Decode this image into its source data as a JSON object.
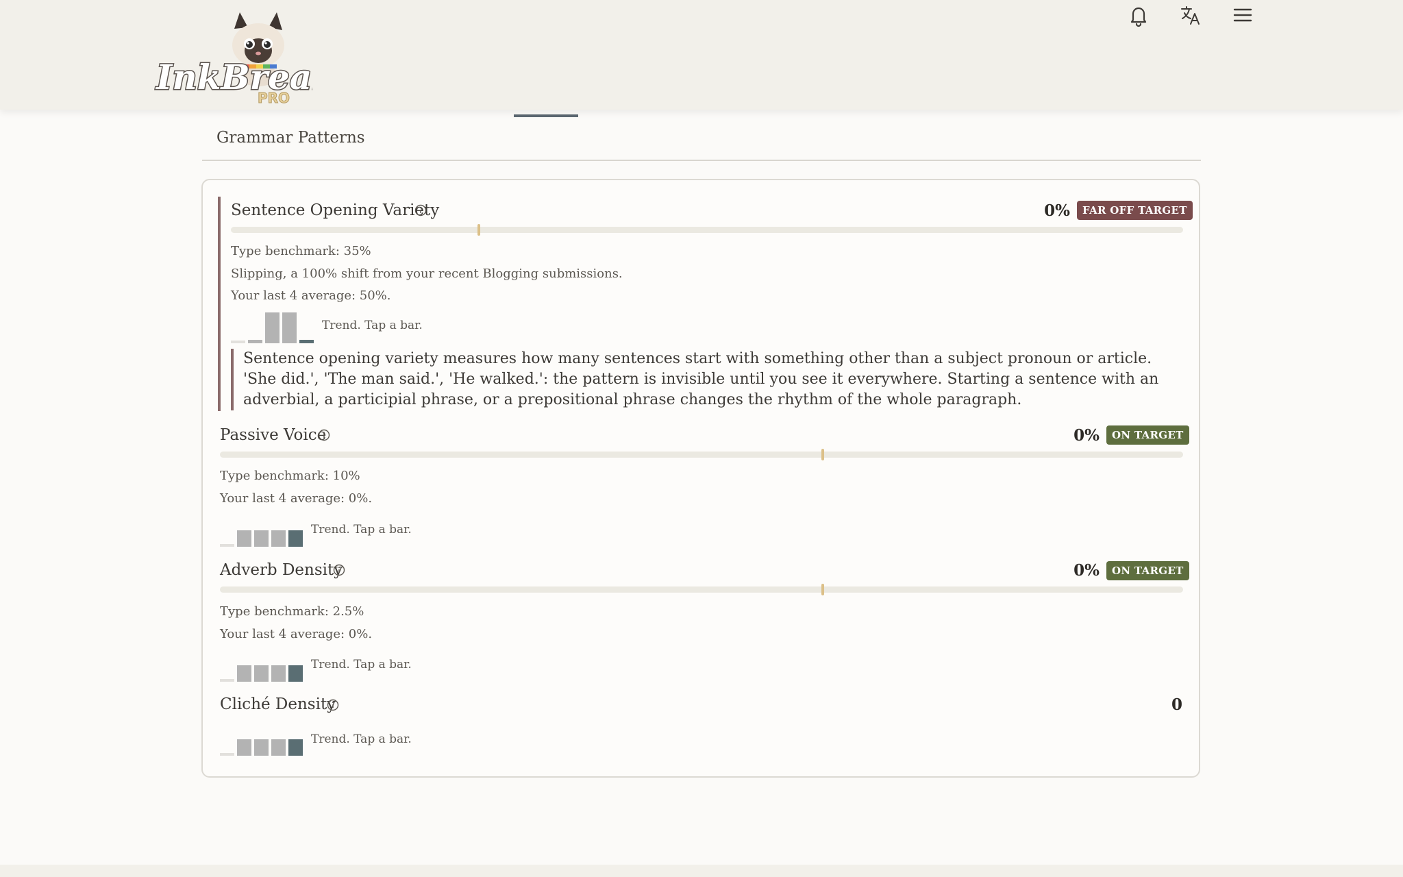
{
  "header": {
    "logo": {
      "brand": "InkBreaker",
      "tier": "PRO"
    },
    "icons": [
      "bell-icon",
      "translate-icon",
      "menu-icon"
    ]
  },
  "section_tab": "Grammar Patterns",
  "metrics": [
    {
      "title": "Sentence Opening Variety",
      "value": "0%",
      "badge": "FAR OFF TARGET",
      "badge_status": "far",
      "benchmark": "Type benchmark: 35%",
      "shift": "Slipping, a 100% shift from your recent Blogging submissions.",
      "average": "Your last 4 average: 50%.",
      "trend_label": "Trend. Tap a bar.",
      "trend_values": [
        0.06,
        0.12,
        1.0,
        1.0,
        0.12
      ],
      "description": "Sentence opening variety measures how many sentences start with something other than a subject pronoun or article. 'She did.', 'The man said.', 'He walked.': the pattern is invisible until you see it everywhere. Starting a sentence with an adverbial, a participial phrase, or a prepositional phrase changes the rhythm of the whole paragraph."
    },
    {
      "title": "Passive Voice",
      "value": "0%",
      "badge": "ON TARGET",
      "badge_status": "on",
      "benchmark": "Type benchmark: 10%",
      "average": "Your last 4 average: 0%.",
      "trend_label": "Trend. Tap a bar.",
      "trend_values": [
        0.12,
        1.0,
        1.0,
        1.0,
        1.0
      ]
    },
    {
      "title": "Adverb Density",
      "value": "0%",
      "badge": "ON TARGET",
      "badge_status": "on",
      "benchmark": "Type benchmark: 2.5%",
      "average": "Your last 4 average: 0%.",
      "trend_label": "Trend. Tap a bar.",
      "trend_values": [
        0.12,
        1.0,
        1.0,
        1.0,
        1.0
      ]
    },
    {
      "title": "Cliché Density",
      "value": "0",
      "trend_label": "Trend. Tap a bar.",
      "trend_values": [
        0.12,
        1.0,
        1.0,
        1.0,
        1.0
      ]
    }
  ],
  "colors": {
    "far_badge": "#7a4b4c",
    "on_badge": "#5e6e3e",
    "trend_bar": "#b3b3b3",
    "trend_bar_current": "#5a6e73",
    "trend_bar_empty": "#e2e0dc",
    "benchmark_marker": "#dcc088"
  }
}
